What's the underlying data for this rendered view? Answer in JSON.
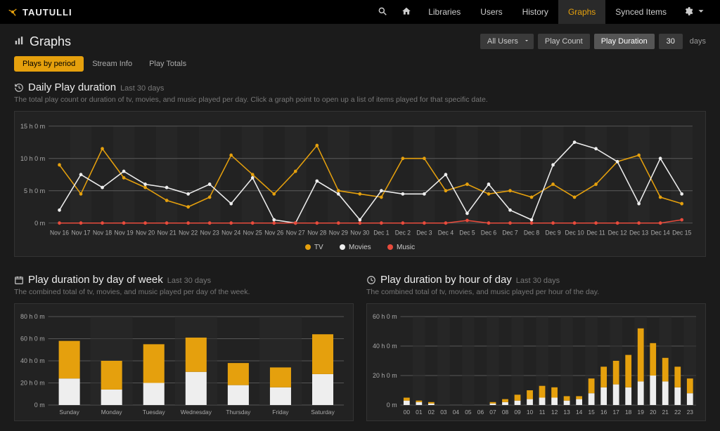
{
  "brand": "TAUTULLI",
  "nav": {
    "libraries": "Libraries",
    "users": "Users",
    "history": "History",
    "graphs": "Graphs",
    "synced_items": "Synced Items"
  },
  "page": {
    "title": "Graphs",
    "user_select": "All Users",
    "play_count_btn": "Play Count",
    "play_duration_btn": "Play Duration",
    "days_value": "30",
    "days_label": "days"
  },
  "tabs": {
    "plays_by_period": "Plays by period",
    "stream_info": "Stream Info",
    "play_totals": "Play Totals"
  },
  "daily": {
    "title": "Daily Play duration",
    "subtitle": "Last 30 days",
    "desc": "The total play count or duration of tv, movies, and music played per day. Click a graph point to open up a list of items played for that specific date."
  },
  "legend": {
    "tv": "TV",
    "movies": "Movies",
    "music": "Music"
  },
  "weekly": {
    "title": "Play duration by day of week",
    "subtitle": "Last 30 days",
    "desc": "The combined total of tv, movies, and music played per day of the week."
  },
  "hourly": {
    "title": "Play duration by hour of day",
    "subtitle": "Last 30 days",
    "desc": "The combined total of tv, movies, and music played per hour of the day."
  },
  "chart_data": [
    {
      "id": "daily",
      "type": "line",
      "categories": [
        "Nov 16",
        "Nov 17",
        "Nov 18",
        "Nov 19",
        "Nov 20",
        "Nov 21",
        "Nov 22",
        "Nov 23",
        "Nov 24",
        "Nov 25",
        "Nov 26",
        "Nov 27",
        "Nov 28",
        "Nov 29",
        "Nov 30",
        "Dec 1",
        "Dec 2",
        "Dec 3",
        "Dec 4",
        "Dec 5",
        "Dec 6",
        "Dec 7",
        "Dec 8",
        "Dec 9",
        "Dec 10",
        "Dec 11",
        "Dec 12",
        "Dec 13",
        "Dec 14",
        "Dec 15"
      ],
      "y_ticks": [
        "0 m",
        "5 h 0 m",
        "10 h 0 m",
        "15 h 0 m"
      ],
      "ylim": [
        0,
        15
      ],
      "series": [
        {
          "name": "TV",
          "color": "#e5a00d",
          "values": [
            9.0,
            4.5,
            11.5,
            7.0,
            5.5,
            3.5,
            2.5,
            4.0,
            10.5,
            7.5,
            4.5,
            8.0,
            12.0,
            5.0,
            4.5,
            4.0,
            10.0,
            10.0,
            5.0,
            6.0,
            4.5,
            5.0,
            4.0,
            6.0,
            4.0,
            6.0,
            9.5,
            10.5,
            4.0,
            3.0
          ]
        },
        {
          "name": "Movies",
          "color": "#eeeeee",
          "values": [
            2.0,
            7.5,
            5.5,
            8.0,
            6.0,
            5.5,
            4.5,
            6.0,
            3.0,
            7.0,
            0.5,
            0.0,
            6.5,
            4.5,
            0.5,
            5.0,
            4.5,
            4.5,
            7.5,
            1.5,
            6.0,
            2.0,
            0.5,
            9.0,
            12.5,
            11.5,
            9.5,
            3.0,
            10.0,
            4.5
          ]
        },
        {
          "name": "Music",
          "color": "#e84b3c",
          "values": [
            0.0,
            0.0,
            0.0,
            0.0,
            0.0,
            0.0,
            0.0,
            0.0,
            0.0,
            0.0,
            0.0,
            0.0,
            0.0,
            0.0,
            0.0,
            0.0,
            0.0,
            0.0,
            0.0,
            0.4,
            0.0,
            0.0,
            0.0,
            0.0,
            0.0,
            0.0,
            0.0,
            0.0,
            0.0,
            0.5
          ]
        }
      ]
    },
    {
      "id": "weekly",
      "type": "bar",
      "categories": [
        "Sunday",
        "Monday",
        "Tuesday",
        "Wednesday",
        "Thursday",
        "Friday",
        "Saturday"
      ],
      "y_ticks": [
        "0 m",
        "20 h 0 m",
        "40 h 0 m",
        "60 h 0 m",
        "80 h 0 m"
      ],
      "ylim": [
        0,
        80
      ],
      "series": [
        {
          "name": "Movies",
          "color": "#eeeeee",
          "values": [
            24,
            14,
            20,
            30,
            18,
            16,
            28
          ]
        },
        {
          "name": "TV",
          "color": "#e5a00d",
          "values": [
            34,
            26,
            35,
            31,
            20,
            18,
            36
          ]
        }
      ]
    },
    {
      "id": "hourly",
      "type": "bar",
      "categories": [
        "00",
        "01",
        "02",
        "03",
        "04",
        "05",
        "06",
        "07",
        "08",
        "09",
        "10",
        "11",
        "12",
        "13",
        "14",
        "15",
        "16",
        "17",
        "18",
        "19",
        "20",
        "21",
        "22",
        "23"
      ],
      "y_ticks": [
        "0 m",
        "20 h 0 m",
        "40 h 0 m",
        "60 h 0 m"
      ],
      "ylim": [
        0,
        60
      ],
      "series": [
        {
          "name": "Movies",
          "color": "#eeeeee",
          "values": [
            3,
            2,
            1,
            0,
            0,
            0,
            0,
            1,
            2,
            3,
            4,
            5,
            5,
            3,
            4,
            8,
            12,
            14,
            12,
            16,
            20,
            16,
            12,
            8
          ]
        },
        {
          "name": "TV",
          "color": "#e5a00d",
          "values": [
            2,
            1,
            1,
            0,
            0,
            0,
            0,
            1,
            2,
            4,
            6,
            8,
            7,
            3,
            2,
            10,
            14,
            16,
            22,
            36,
            22,
            16,
            14,
            10
          ]
        }
      ]
    }
  ]
}
